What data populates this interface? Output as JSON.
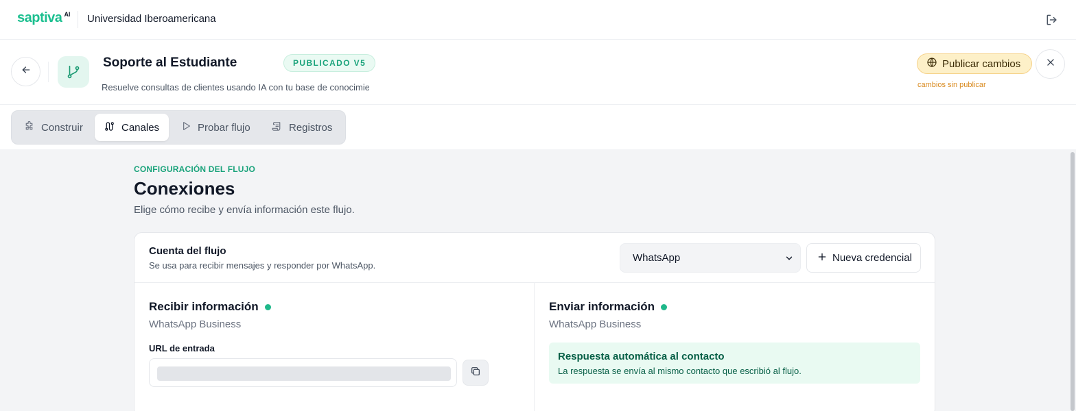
{
  "topbar": {
    "logo_text": "saptiva",
    "logo_sup": "AI",
    "org_name": "Universidad Iberoamericana",
    "logout_icon": "logout-icon"
  },
  "header": {
    "back_icon": "arrow-left-icon",
    "flow_icon": "git-branch-icon",
    "title": "Soporte al Estudiante",
    "badge": "PUBLICADO V5",
    "description": "Resuelve consultas de clientes usando IA con tu base de conocimiento",
    "publish_label": "Publicar cambios",
    "publish_icon": "globe-icon",
    "unpublished_note": "cambios sin publicar",
    "close_icon": "close-icon"
  },
  "tabs": [
    {
      "label": "Construir",
      "icon": "puzzle-icon",
      "active": false
    },
    {
      "label": "Canales",
      "icon": "route-icon",
      "active": true
    },
    {
      "label": "Probar flujo",
      "icon": "play-icon",
      "active": false
    },
    {
      "label": "Registros",
      "icon": "scroll-icon",
      "active": false
    }
  ],
  "main": {
    "eyebrow": "CONFIGURACIÓN DEL FLUJO",
    "title": "Conexiones",
    "subtitle": "Elige cómo recibe y envía información este flujo.",
    "account": {
      "title": "Cuenta del flujo",
      "subtitle": "Se usa para recibir mensajes y responder por WhatsApp.",
      "selected_channel": "WhatsApp",
      "new_credential_label": "Nueva credencial"
    },
    "receive": {
      "title": "Recibir información",
      "provider": "WhatsApp Business",
      "url_label": "URL de entrada"
    },
    "send": {
      "title": "Enviar información",
      "provider": "WhatsApp Business",
      "notice_title": "Respuesta automática al contacto",
      "notice_text": "La respuesta se envía al mismo contacto que escribió al flujo."
    }
  },
  "colors": {
    "accent": "#1aa37b",
    "status_dot": "#1fb88a",
    "publish_bg": "#fdf0c8",
    "warning_text": "#d98a1f"
  }
}
